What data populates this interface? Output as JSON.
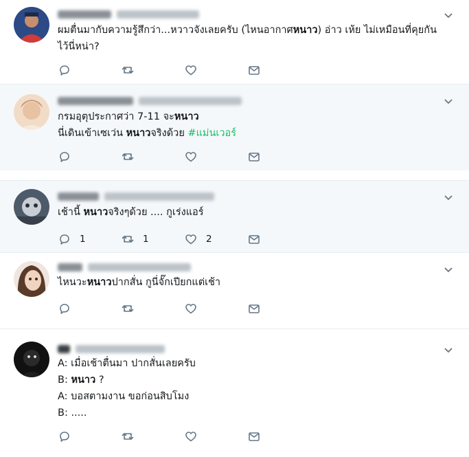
{
  "tweets": [
    {
      "body": [
        [
          {
            "t": "ผมตื่นมากับความรู้สึกว่า...หวาวจังเลยครับ (ไหนอากาศ"
          },
          {
            "t": "หนาว",
            "b": true
          },
          {
            "t": ") อ่าว เห้ย ไม่เหมือนที่คุยกัน"
          }
        ],
        [
          {
            "t": "ไว้นี่หน่า?"
          }
        ]
      ],
      "counts": {
        "reply": "",
        "retweet": "",
        "like": ""
      }
    },
    {
      "body": [
        [
          {
            "t": "กรมอุตุประกาศว่า 7-11 จะ"
          },
          {
            "t": "หนาว",
            "b": true
          }
        ],
        [
          {
            "t": "นี่เดินเข้าเซเว่น "
          },
          {
            "t": "หนาว",
            "b": true
          },
          {
            "t": "จริงด้วย "
          },
          {
            "t": "#แม่นเวอร์",
            "h": true
          }
        ]
      ],
      "counts": {
        "reply": "",
        "retweet": "",
        "like": ""
      }
    },
    {
      "body": [
        [
          {
            "t": "เช้านี้ "
          },
          {
            "t": "หนาว",
            "b": true
          },
          {
            "t": "จริงๆด้วย .... กูเร่งแอร์"
          }
        ]
      ],
      "counts": {
        "reply": "1",
        "retweet": "1",
        "like": "2"
      }
    },
    {
      "body": [
        [
          {
            "t": "ไหนวะ"
          },
          {
            "t": "หนาว",
            "b": true
          },
          {
            "t": "ปากสั่น กูนี่จั๊กเปียกแต่เช้า"
          }
        ]
      ],
      "counts": {
        "reply": "",
        "retweet": "",
        "like": ""
      }
    },
    {
      "body": [
        [
          {
            "t": "A: เมื่อเช้าตื่นมา ปากสั่นเลยครับ"
          }
        ],
        [
          {
            "t": "B: "
          },
          {
            "t": "หนาว",
            "b": true
          },
          {
            "t": " ?"
          }
        ],
        [
          {
            "t": "A: บอสตามงาน ขอก่อนสิบโมง"
          }
        ],
        [
          {
            "t": "B: ....."
          }
        ]
      ],
      "counts": {
        "reply": "",
        "retweet": "",
        "like": ""
      }
    }
  ],
  "icons": {
    "reply": "reply-icon",
    "retweet": "retweet-icon",
    "like": "like-icon",
    "dm": "direct-message-icon",
    "more": "chevron-down-icon"
  },
  "colors": {
    "text": "#14171a",
    "icon": "#657786",
    "hashtag": "#17bf63",
    "shaded_bg": "#f5f8fa",
    "divider": "#e6ecf0"
  }
}
